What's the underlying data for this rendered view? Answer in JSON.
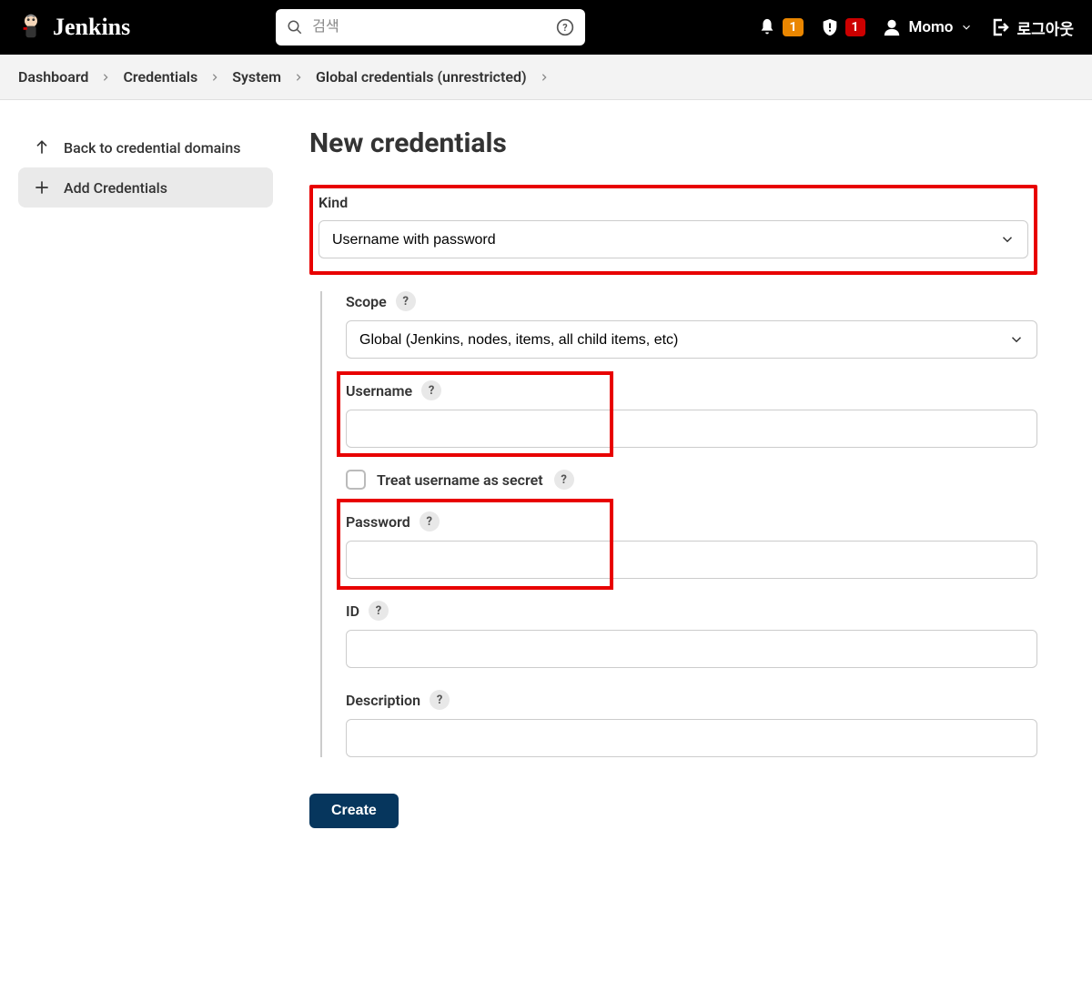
{
  "header": {
    "brand": "Jenkins",
    "search_placeholder": "검색",
    "badge1": "1",
    "badge2": "1",
    "username": "Momo",
    "logout": "로그아웃"
  },
  "breadcrumb": {
    "items": [
      "Dashboard",
      "Credentials",
      "System",
      "Global credentials (unrestricted)"
    ]
  },
  "sidebar": {
    "back": "Back to credential domains",
    "add": "Add Credentials"
  },
  "page": {
    "title": "New credentials",
    "kind_label": "Kind",
    "kind_value": "Username with password",
    "scope_label": "Scope",
    "scope_value": "Global (Jenkins, nodes, items, all child items, etc)",
    "username_label": "Username",
    "treat_secret_label": "Treat username as secret",
    "password_label": "Password",
    "id_label": "ID",
    "description_label": "Description",
    "create_button": "Create",
    "help": "?"
  }
}
